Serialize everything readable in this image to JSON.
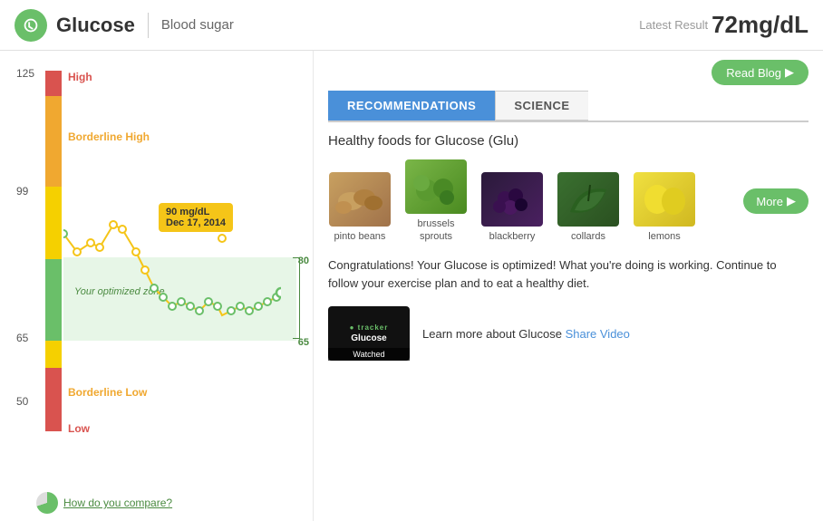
{
  "header": {
    "title": "Glucose",
    "subtitle": "Blood sugar",
    "latest_label": "Latest Result",
    "latest_value": "72mg/dL"
  },
  "chart": {
    "y_labels": [
      "125",
      "99",
      "65",
      "50"
    ],
    "zones": {
      "high": "High",
      "borderline_high": "Borderline High",
      "optimized": "Your optimized zone",
      "borderline_low": "Borderline Low",
      "low": "Low"
    },
    "bracket_80": "80",
    "bracket_65": "65",
    "tooltip": {
      "value": "90 mg/dL",
      "date": "Dec 17, 2014"
    },
    "compare_link": "How do you compare?"
  },
  "right_panel": {
    "read_blog_label": "Read Blog",
    "tabs": [
      {
        "label": "Recommendations",
        "active": true
      },
      {
        "label": "Science",
        "active": false
      }
    ],
    "section_title": "Healthy foods for Glucose (Glu)",
    "foods": [
      {
        "name": "pinto beans",
        "color_class": "food-pinto"
      },
      {
        "name": "brussels sprouts",
        "color_class": "food-brussels"
      },
      {
        "name": "blackberry",
        "color_class": "food-blackberry"
      },
      {
        "name": "collards",
        "color_class": "food-collards"
      },
      {
        "name": "lemons",
        "color_class": "food-lemons"
      }
    ],
    "more_label": "More",
    "congrats_text": "Congratulations! Your Glucose is optimized! What you're doing is working. Continue to follow your exercise plan and to eat a healthy diet.",
    "video": {
      "title": "tracker",
      "label": "Glucose",
      "watched": "Watched",
      "desc_prefix": "Learn more about Glucose",
      "share_link": "Share Video"
    }
  }
}
